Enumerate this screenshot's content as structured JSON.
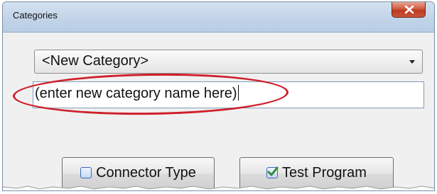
{
  "window": {
    "title": "Categories",
    "close_label": "x"
  },
  "category_dropdown": {
    "selected": "<New Category>"
  },
  "new_category_input": {
    "value": "(enter new category name here)"
  },
  "buttons": {
    "connector_type": {
      "label": "Connector Type",
      "checked": false,
      "icon": "checkbox-unchecked-icon"
    },
    "test_program": {
      "label": "Test Program",
      "checked": true,
      "icon": "checkbox-checked-icon"
    }
  },
  "colors": {
    "highlight": "#cf1f2a",
    "close_button": "#c9543a",
    "check_mark": "#2e8b3a"
  }
}
